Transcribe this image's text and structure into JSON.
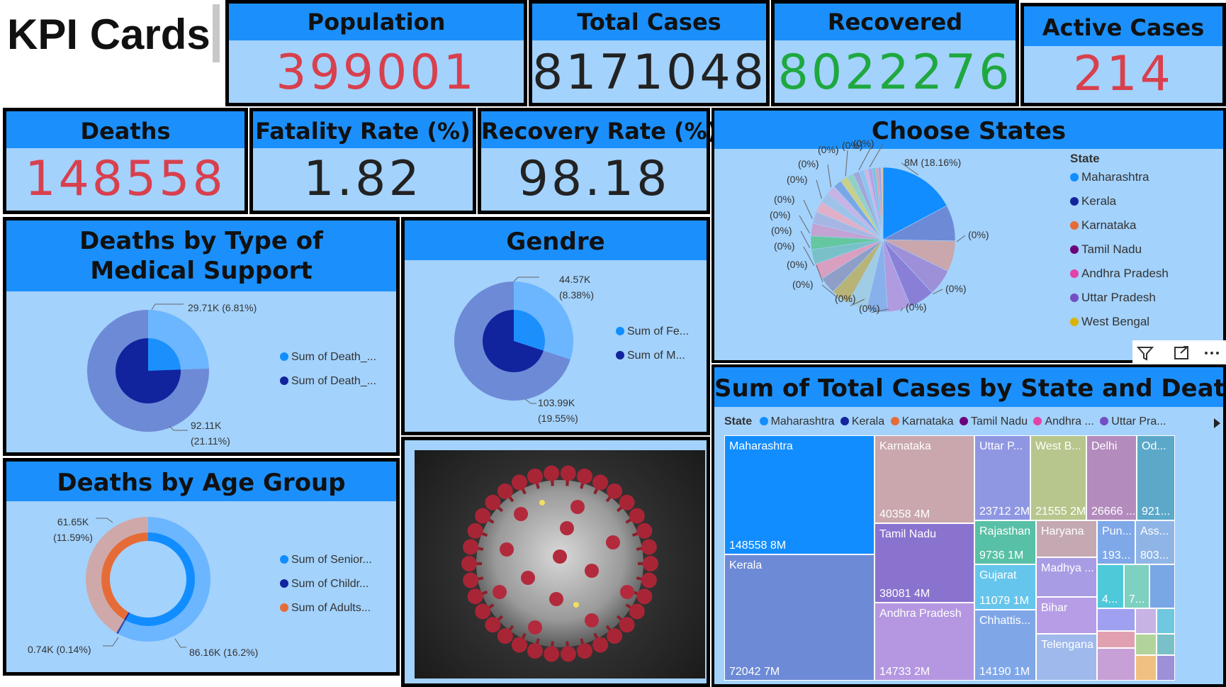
{
  "page_title": "KPI Cards",
  "kpis": {
    "population": {
      "label": "Population",
      "value": "399001",
      "color": "#d8404e"
    },
    "total_cases": {
      "label": "Total Cases",
      "value": "8171048",
      "color": "#222222"
    },
    "recovered": {
      "label": "Recovered",
      "value": "8022276",
      "color": "#1fa83f"
    },
    "active_cases": {
      "label": "Active Cases",
      "value": "214",
      "color": "#d8404e"
    },
    "deaths": {
      "label": "Deaths",
      "value": "148558",
      "color": "#d8404e"
    },
    "fatality_rate": {
      "label": "Fatality Rate (%)",
      "value": "1.82",
      "color": "#222222"
    },
    "recovery_rate": {
      "label": "Recovery Rate (%)",
      "value": "98.18",
      "color": "#222222"
    }
  },
  "visual_header_icons": [
    "filter-icon",
    "focus-mode-icon",
    "more-options-icon"
  ],
  "chart_data": [
    {
      "type": "pie",
      "title": "Deaths by Type of Medical Support",
      "series": [
        {
          "name": "Sum of Death_...",
          "values": [
            29710,
            92110
          ],
          "labels": [
            "29.71K (6.81%)",
            "92.11K (21.11%)"
          ]
        },
        {
          "name": "Sum of Death_...",
          "values": [
            29710,
            92110
          ]
        }
      ],
      "legend": [
        "Sum of Death_...",
        "Sum of Death_..."
      ],
      "legend_position": "right"
    },
    {
      "type": "pie",
      "title": "Gendre",
      "series": [
        {
          "name": "Sum of Fe...",
          "values": [
            44570,
            103990
          ],
          "labels": [
            "44.57K (8.38%)",
            "103.99K (19.55%)"
          ]
        },
        {
          "name": "Sum of M...",
          "values": [
            44570,
            103990
          ]
        }
      ],
      "legend": [
        "Sum of Fe...",
        "Sum of M..."
      ],
      "legend_position": "right"
    },
    {
      "type": "pie",
      "title": "Deaths by Age Group",
      "series": [
        {
          "name": "Sum of Senior...",
          "value": 86160,
          "label": "86.16K (16.2%)"
        },
        {
          "name": "Sum of Childr...",
          "value": 740,
          "label": "0.74K (0.14%)"
        },
        {
          "name": "Sum of Adults...",
          "value": 61650,
          "label": "61.65K (11.59%)"
        }
      ],
      "legend": [
        "Sum of Senior...",
        "Sum of Childr...",
        "Sum of Adults..."
      ],
      "legend_position": "right"
    },
    {
      "type": "pie",
      "title": "Choose States",
      "legend_title": "State",
      "legend": [
        "Maharashtra",
        "Kerala",
        "Karnataka",
        "Tamil Nadu",
        "Andhra Pradesh",
        "Uttar Pradesh",
        "West Bengal"
      ],
      "legend_position": "right",
      "slice_labels": [
        "8M (18.16%)",
        "(0%)",
        "(0%)",
        "(0%)",
        "(0%)",
        "(0%)",
        "(0%)",
        "(0%)",
        "(0%)",
        "(0%)",
        "(0%)",
        "(0%)",
        "(0%)",
        "(0%)",
        "(0%)",
        "(0%)",
        "(0%)"
      ],
      "values": [
        18.16,
        8.5,
        7.3,
        6.2,
        6.0,
        5.5,
        5.0,
        4.6,
        4.3,
        4.0,
        3.7,
        3.5,
        3.2,
        3.0,
        2.8,
        2.6,
        2.4,
        2.2,
        2.0,
        1.8,
        1.6,
        1.4,
        1.2,
        1.0,
        0.9,
        0.8,
        0.7,
        0.6,
        0.5
      ]
    },
    {
      "type": "treemap",
      "title": "Sum of Total Cases by State and Deaths",
      "legend_title": "State",
      "legend": [
        "Maharashtra",
        "Kerala",
        "Karnataka",
        "Tamil Nadu",
        "Andhra ...",
        "Uttar Pra..."
      ],
      "tiles": [
        {
          "name": "Maharashtra",
          "value": "148558 8M"
        },
        {
          "name": "Kerala",
          "value": "72042 7M"
        },
        {
          "name": "Karnataka",
          "value": "40358 4M"
        },
        {
          "name": "Tamil Nadu",
          "value": "38081 4M"
        },
        {
          "name": "Andhra Pradesh",
          "value": "14733 2M"
        },
        {
          "name": "Uttar P...",
          "value": "23712 2M"
        },
        {
          "name": "West B...",
          "value": "21555 2M"
        },
        {
          "name": "Delhi",
          "value": "26666 ..."
        },
        {
          "name": "Od...",
          "value": "921..."
        },
        {
          "name": "Rajasthan",
          "value": "9736 1M"
        },
        {
          "name": "Gujarat",
          "value": "11079 1M"
        },
        {
          "name": "Chhattis...",
          "value": "14190 1M"
        },
        {
          "name": "Haryana",
          "value": ""
        },
        {
          "name": "Madhya ...",
          "value": ""
        },
        {
          "name": "Bihar",
          "value": ""
        },
        {
          "name": "Telengana",
          "value": ""
        },
        {
          "name": "Pun...",
          "value": "193..."
        },
        {
          "name": "Ass...",
          "value": "803..."
        },
        {
          "name": "",
          "value": "4..."
        },
        {
          "name": "",
          "value": "7..."
        }
      ]
    }
  ],
  "colors": {
    "card_bg": "#a3d2fc",
    "header_bg": "#1b90fc",
    "maharashtra": "#118dff",
    "kerala": "#12239e",
    "karnataka": "#e66c37",
    "tamil_nadu": "#6b007b",
    "andhra_pradesh": "#e044a7",
    "uttar_pradesh": "#744ec2",
    "west_bengal": "#d9b300"
  }
}
